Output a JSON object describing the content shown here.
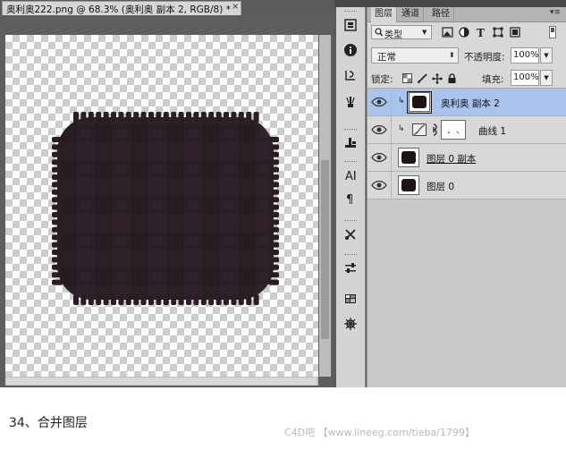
{
  "document": {
    "tab_title": "奥利奥222.png @ 68.3% (奥利奥 副本 2, RGB/8) *",
    "close_glyph": "×",
    "biscuit_color": "#2a1d24"
  },
  "dock": {
    "collapse_left": "◂◂",
    "collapse_right": "▸▸"
  },
  "tools": [
    {
      "name": "layer-comps-icon"
    },
    {
      "name": "info-icon"
    },
    {
      "name": "history-icon"
    },
    {
      "name": "brush-presets-icon"
    },
    {
      "name": "clone-source-icon"
    },
    {
      "name": "character-icon"
    },
    {
      "name": "paragraph-icon"
    },
    {
      "name": "tool-presets-icon"
    },
    {
      "name": "adjustments-icon"
    },
    {
      "name": "swatches-icon"
    },
    {
      "name": "navigator-icon"
    }
  ],
  "panel": {
    "tabs": [
      "图层",
      "通道",
      "路径"
    ],
    "menu_glyph": "▾≡",
    "filter_label": "类型",
    "blend_mode": "正常",
    "opacity_label": "不透明度:",
    "opacity_value": "100%",
    "lock_label": "锁定:",
    "fill_label": "填充:",
    "fill_value": "100%"
  },
  "layers": [
    {
      "name": "奥利奥 副本 2",
      "selected": true,
      "clipped": true
    },
    {
      "name": "曲线 1",
      "selected": false,
      "clipped": true,
      "type": "adjustment"
    },
    {
      "name": "图层 0 副本",
      "selected": false,
      "clipped": false
    },
    {
      "name": "图层 0",
      "selected": false,
      "clipped": false
    }
  ],
  "caption": "34、合并图层",
  "watermark": "C4D吧 【www.lineeg.com/tieba/1799】"
}
